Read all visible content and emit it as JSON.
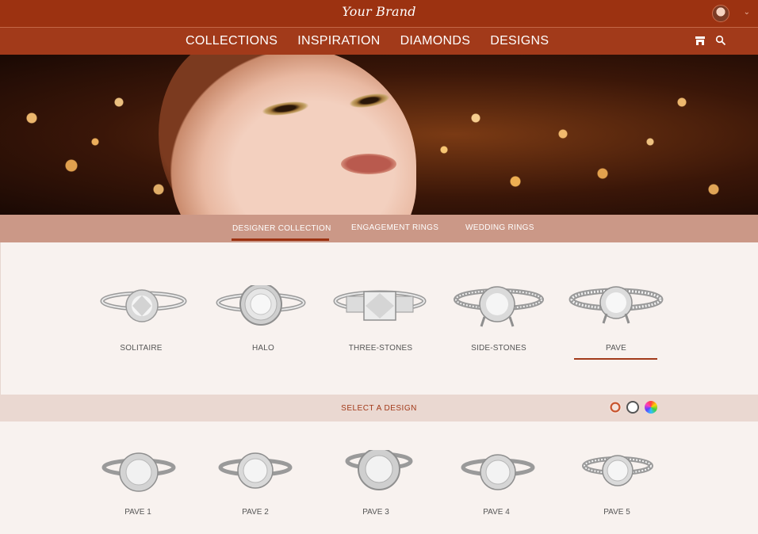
{
  "header": {
    "brand": "Your Brand"
  },
  "nav": {
    "items": [
      "COLLECTIONS",
      "INSPIRATION",
      "DIAMONDS",
      "DESIGNS"
    ],
    "icons": [
      "store-icon",
      "search-icon"
    ]
  },
  "tabs": {
    "items": [
      "DESIGNER COLLECTION",
      "ENGAGEMENT RINGS",
      "WEDDING RINGS"
    ],
    "active": "DESIGNER COLLECTION"
  },
  "styles": {
    "items": [
      "SOLITAIRE",
      "HALO",
      "THREE-STONES",
      "SIDE-STONES",
      "PAVE"
    ],
    "active": "PAVE"
  },
  "select": {
    "label": "SELECT A DESIGN",
    "swatches": [
      "rose-gold",
      "white",
      "multicolor"
    ]
  },
  "designs": {
    "items": [
      "PAVE 1",
      "PAVE 2",
      "PAVE 3",
      "PAVE 4",
      "PAVE 5"
    ]
  },
  "colors": {
    "brand": "#9c3211",
    "nav": "#a23a1a",
    "tabs": "#cb9887",
    "selectbar": "#ead8d1",
    "background": "#f8f2ef"
  }
}
